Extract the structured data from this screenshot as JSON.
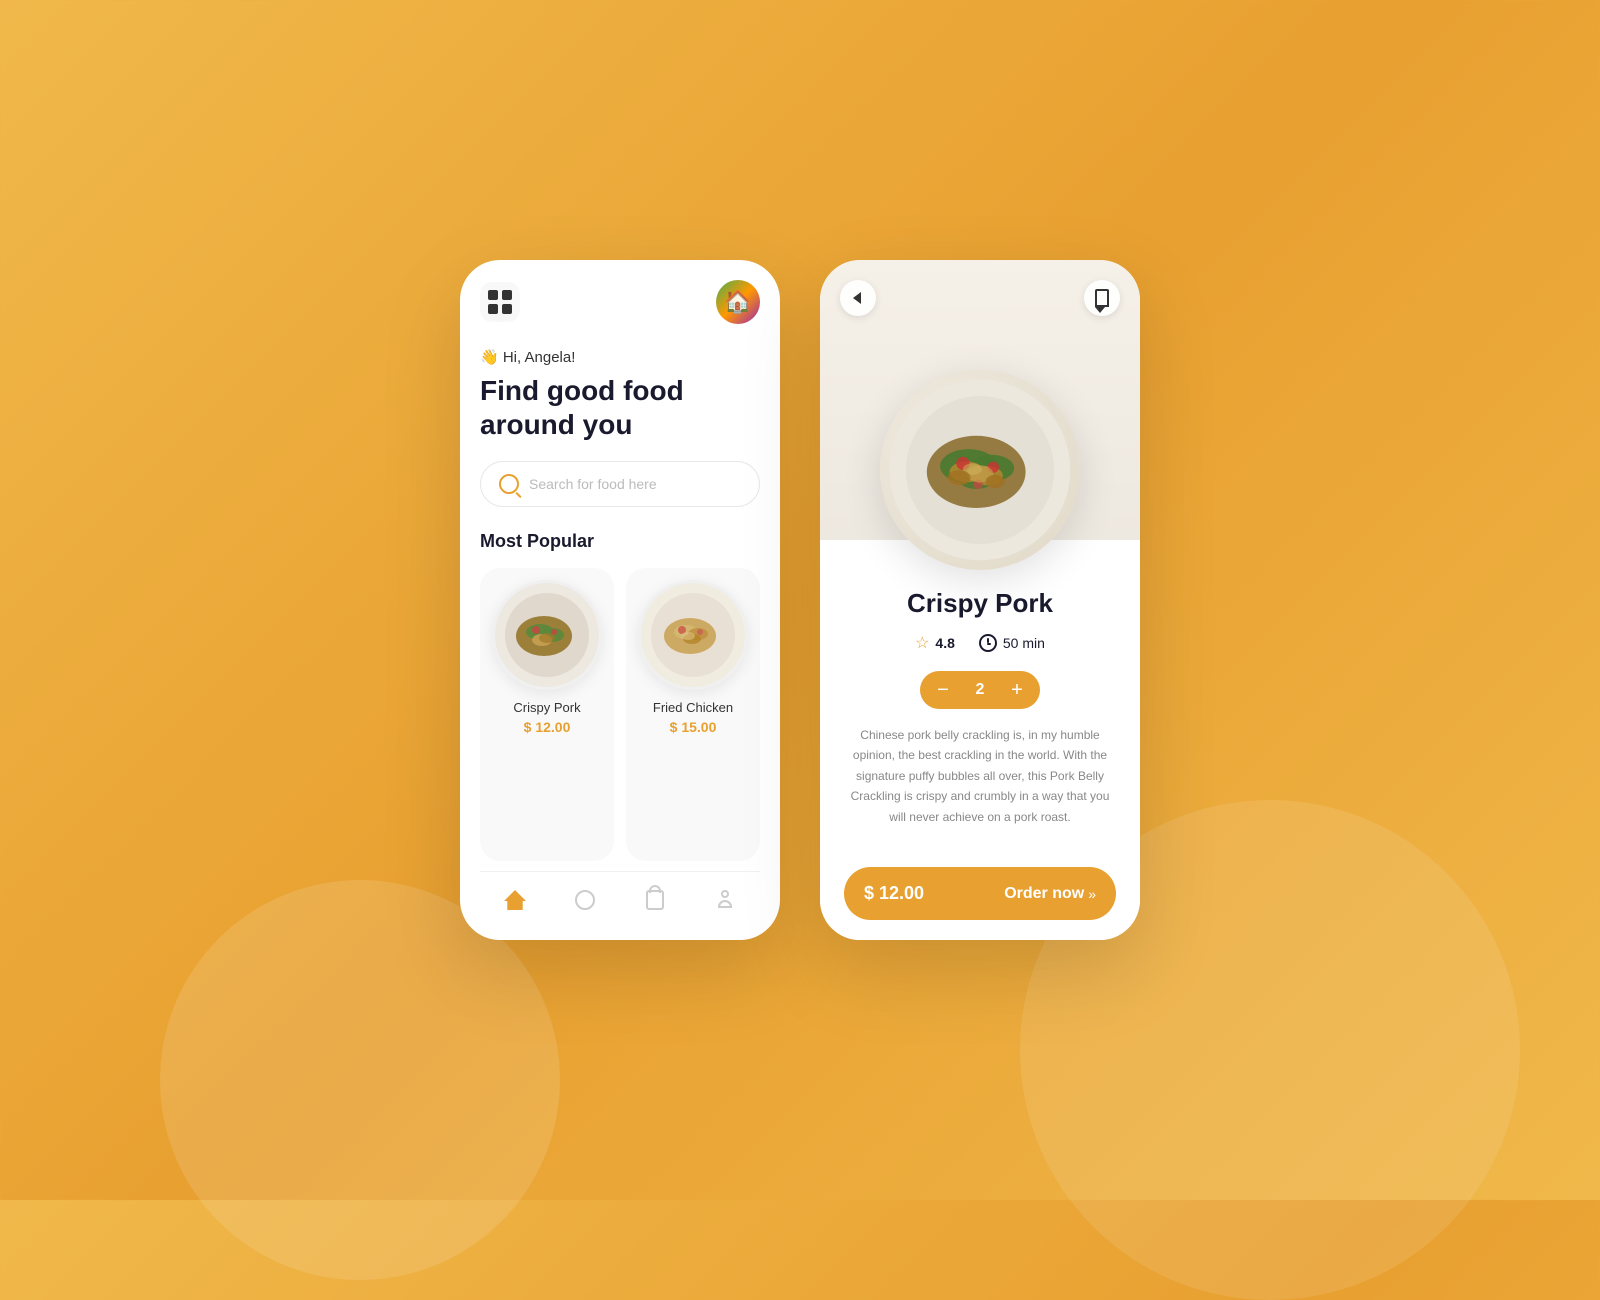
{
  "background": {
    "color": "#e8a030"
  },
  "phone1": {
    "greeting": "👋 Hi, Angela!",
    "headline": "Find good food\naround you",
    "search": {
      "placeholder": "Search for food here"
    },
    "section": {
      "title": "Most Popular"
    },
    "foods": [
      {
        "name": "Crispy Pork",
        "price": "$ 12.00",
        "emoji": "🍽️"
      },
      {
        "name": "Fried Chicken",
        "price": "$ 15.00",
        "emoji": "🍽️"
      }
    ],
    "nav": {
      "items": [
        "home",
        "explore",
        "bag",
        "profile"
      ]
    }
  },
  "phone2": {
    "back_label": "←",
    "bookmark_label": "🔖",
    "dish": {
      "name": "Crispy Pork",
      "rating": "4.8",
      "time": "50 min",
      "quantity": "2",
      "description": "Chinese pork belly crackling is, in my humble opinion, the best crackling in the world. With the signature puffy bubbles all over, this Pork Belly Crackling is crispy and crumbly in a way that you will never achieve on a pork roast.",
      "price": "$ 12.00",
      "order_label": "Order now",
      "order_arrows": "»"
    }
  }
}
